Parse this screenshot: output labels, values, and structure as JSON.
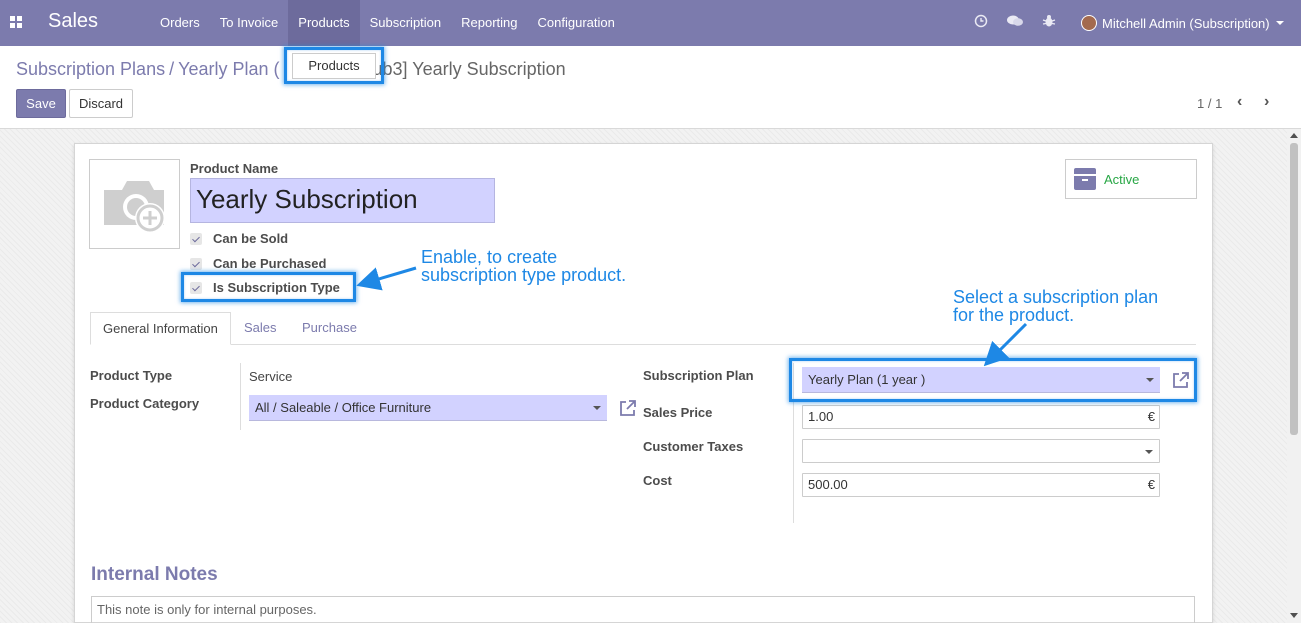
{
  "navbar": {
    "brand": "Sales",
    "menu": [
      "Orders",
      "To Invoice",
      "Products",
      "Subscription",
      "Reporting",
      "Configuration"
    ],
    "active_menu": "Products",
    "user": "Mitchell Admin (Subscription)"
  },
  "dropdown": {
    "item": "Products"
  },
  "breadcrumb": {
    "root": "Subscription Plans",
    "sep": "/",
    "middle": "Yearly Plan (",
    "current": "ub3] Yearly Subscription"
  },
  "buttons": {
    "save": "Save",
    "discard": "Discard"
  },
  "pager": {
    "value": "1 / 1"
  },
  "form": {
    "product_name_label": "Product Name",
    "product_name": "Yearly Subscription",
    "can_be_sold": "Can be Sold",
    "can_be_purchased": "Can be Purchased",
    "is_subscription_type": "Is Subscription Type",
    "active_label": "Active",
    "tabs": [
      "General Information",
      "Sales",
      "Purchase"
    ],
    "product_type_label": "Product Type",
    "product_type": "Service",
    "product_category_label": "Product Category",
    "product_category": "All / Saleable / Office Furniture",
    "subscription_plan_label": "Subscription Plan",
    "subscription_plan": "Yearly Plan (1 year )",
    "sales_price_label": "Sales Price",
    "sales_price": "1.00",
    "customer_taxes_label": "Customer Taxes",
    "customer_taxes": "",
    "cost_label": "Cost",
    "cost": "500.00",
    "currency": "€",
    "internal_notes_title": "Internal Notes",
    "internal_notes": "This note is only for internal purposes."
  },
  "annotations": {
    "callout1_line1": "Enable, to create",
    "callout1_line2": "subscription type product.",
    "callout2_line1": "Select a subscription plan",
    "callout2_line2": "for the product."
  },
  "colors": {
    "navbar": "#7c7bad",
    "required_field": "#d2d2ff",
    "highlight": "#1e88e5",
    "active_green": "#28a745"
  }
}
